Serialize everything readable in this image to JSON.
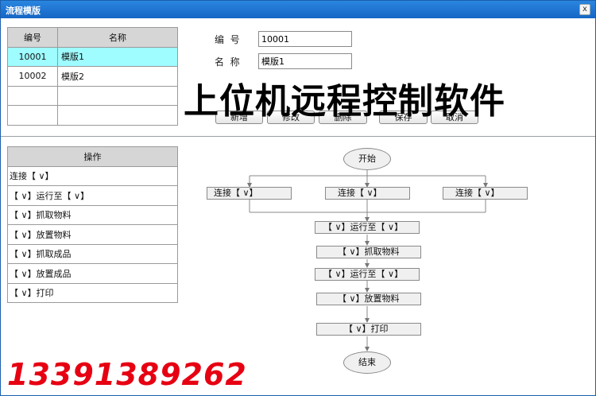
{
  "window": {
    "title": "流程模版",
    "close_glyph": "x"
  },
  "templates": {
    "headers": {
      "id": "编号",
      "name": "名称"
    },
    "rows": [
      {
        "id": "10001",
        "name": "模版1"
      },
      {
        "id": "10002",
        "name": "模版2"
      }
    ]
  },
  "form": {
    "id_label": "编  号",
    "id_value": "10001",
    "name_label": "名  称",
    "name_value": "模版1"
  },
  "buttons": {
    "add": "新增",
    "edit": "修改",
    "delete": "删除",
    "save": "保存",
    "cancel": "取消"
  },
  "overlay_text": "上位机远程控制软件",
  "phone": "13391389262",
  "operations": {
    "header": "操作",
    "items": [
      "连接【    ∨】",
      "【    ∨】运行至【    ∨】",
      "【    ∨】抓取物料",
      "【    ∨】放置物料",
      "【    ∨】抓取成品",
      "【    ∨】放置成品",
      "【    ∨】打印"
    ]
  },
  "flow": {
    "start": "开始",
    "end": "结束",
    "connect_nodes": [
      "连接【     ∨】",
      "连接【       ∨】",
      "连接【       ∨】"
    ],
    "steps": [
      "【    ∨】运行至【    ∨】",
      "【    ∨】抓取物料",
      "【    ∨】运行至【    ∨】",
      "【    ∨】放置物料",
      "【    ∨】打印"
    ]
  }
}
